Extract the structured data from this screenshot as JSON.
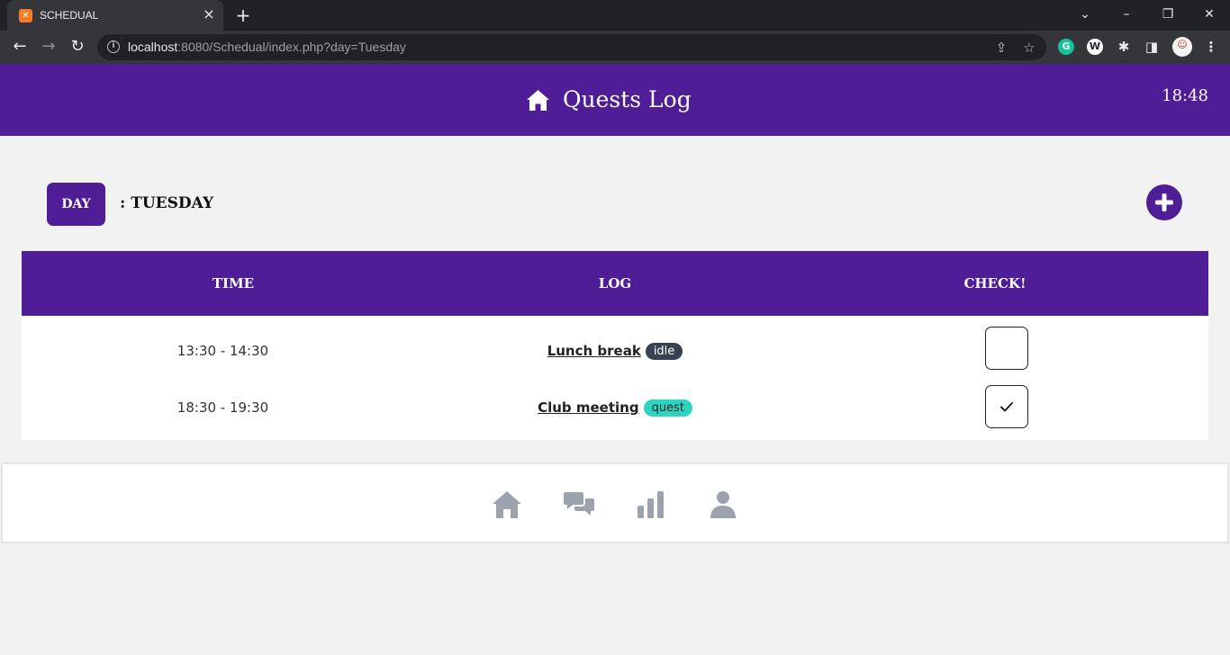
{
  "browser": {
    "tab_title": "SCHEDUAL",
    "tab_favicon": "xampp-icon",
    "url_host": "localhost",
    "url_rest": ":8080/Schedual/index.php?day=Tuesday"
  },
  "header": {
    "title": "Quests Log",
    "clock": "18:48"
  },
  "day": {
    "badge": "DAY",
    "label": ": TUESDAY"
  },
  "table": {
    "headers": [
      "TIME",
      "LOG",
      "CHECK!"
    ],
    "rows": [
      {
        "time": "13:30 - 14:30",
        "title": "Lunch break",
        "tag": "idle",
        "checked": false
      },
      {
        "time": "18:30 - 19:30",
        "title": "Club meeting",
        "tag": "quest",
        "checked": true
      }
    ]
  },
  "bottom_nav": {
    "items": [
      "home-icon",
      "chat-icon",
      "stats-icon",
      "profile-icon"
    ]
  },
  "colors": {
    "brand": "#4f1d96",
    "tag_idle": "#374151",
    "tag_quest": "#2dd4bf",
    "nav_icon": "#9ca3af"
  }
}
